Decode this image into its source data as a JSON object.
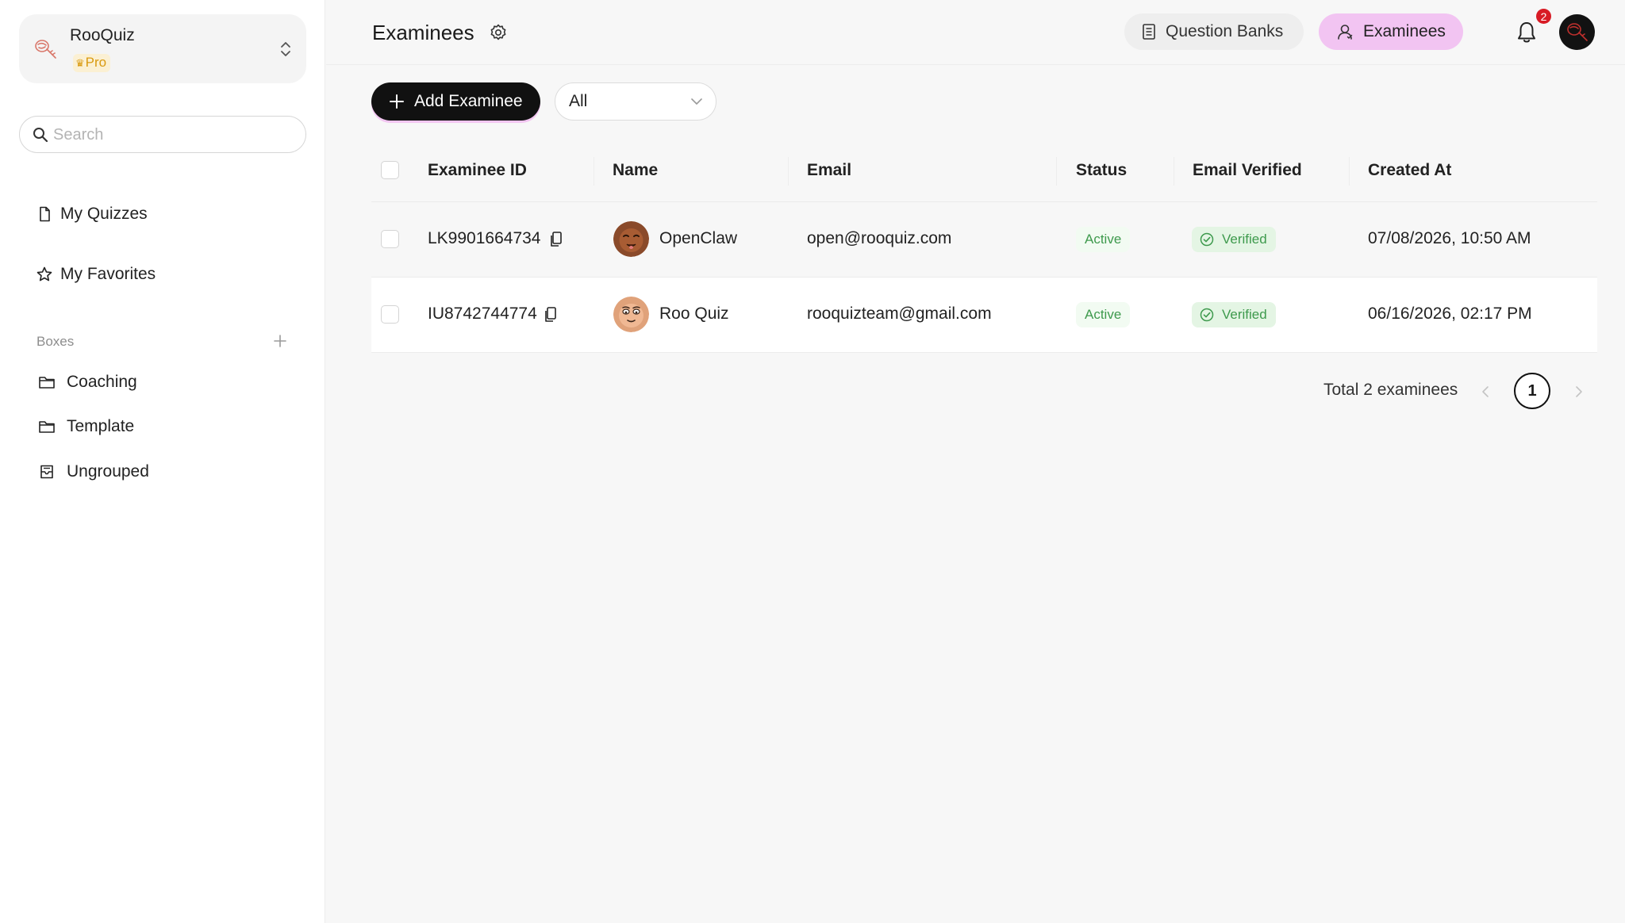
{
  "workspace": {
    "name": "RooQuiz",
    "plan": "Pro"
  },
  "sidebar": {
    "search_placeholder": "Search",
    "nav": [
      {
        "label": "My Quizzes",
        "icon": "document-icon"
      },
      {
        "label": "My Favorites",
        "icon": "star-icon"
      }
    ],
    "boxes_label": "Boxes",
    "boxes": [
      {
        "label": "Coaching",
        "icon": "folder-icon"
      },
      {
        "label": "Template",
        "icon": "folder-icon"
      },
      {
        "label": "Ungrouped",
        "icon": "inbox-icon"
      }
    ]
  },
  "header": {
    "title": "Examinees",
    "question_banks_label": "Question Banks",
    "examinees_label": "Examinees",
    "notification_count": "2"
  },
  "toolbar": {
    "add_label": "Add Examinee",
    "filter_value": "All"
  },
  "table": {
    "columns": [
      "Examinee ID",
      "Name",
      "Email",
      "Status",
      "Email Verified",
      "Created At"
    ],
    "rows": [
      {
        "id": "LK9901664734",
        "name": "OpenClaw",
        "email": "open@rooquiz.com",
        "status": "Active",
        "verified": "Verified",
        "created": "07/08/2026, 10:50 AM"
      },
      {
        "id": "IU8742744774",
        "name": "Roo Quiz",
        "email": "rooquizteam@gmail.com",
        "status": "Active",
        "verified": "Verified",
        "created": "06/16/2026, 02:17 PM"
      }
    ]
  },
  "pagination": {
    "total_text": "Total 2 examinees",
    "current_page": "1"
  },
  "colors": {
    "accent_pink": "#f2c4f2",
    "active_green": "#3e9a4d",
    "pro_gold": "#d99a10",
    "badge_red": "#d81b25"
  }
}
